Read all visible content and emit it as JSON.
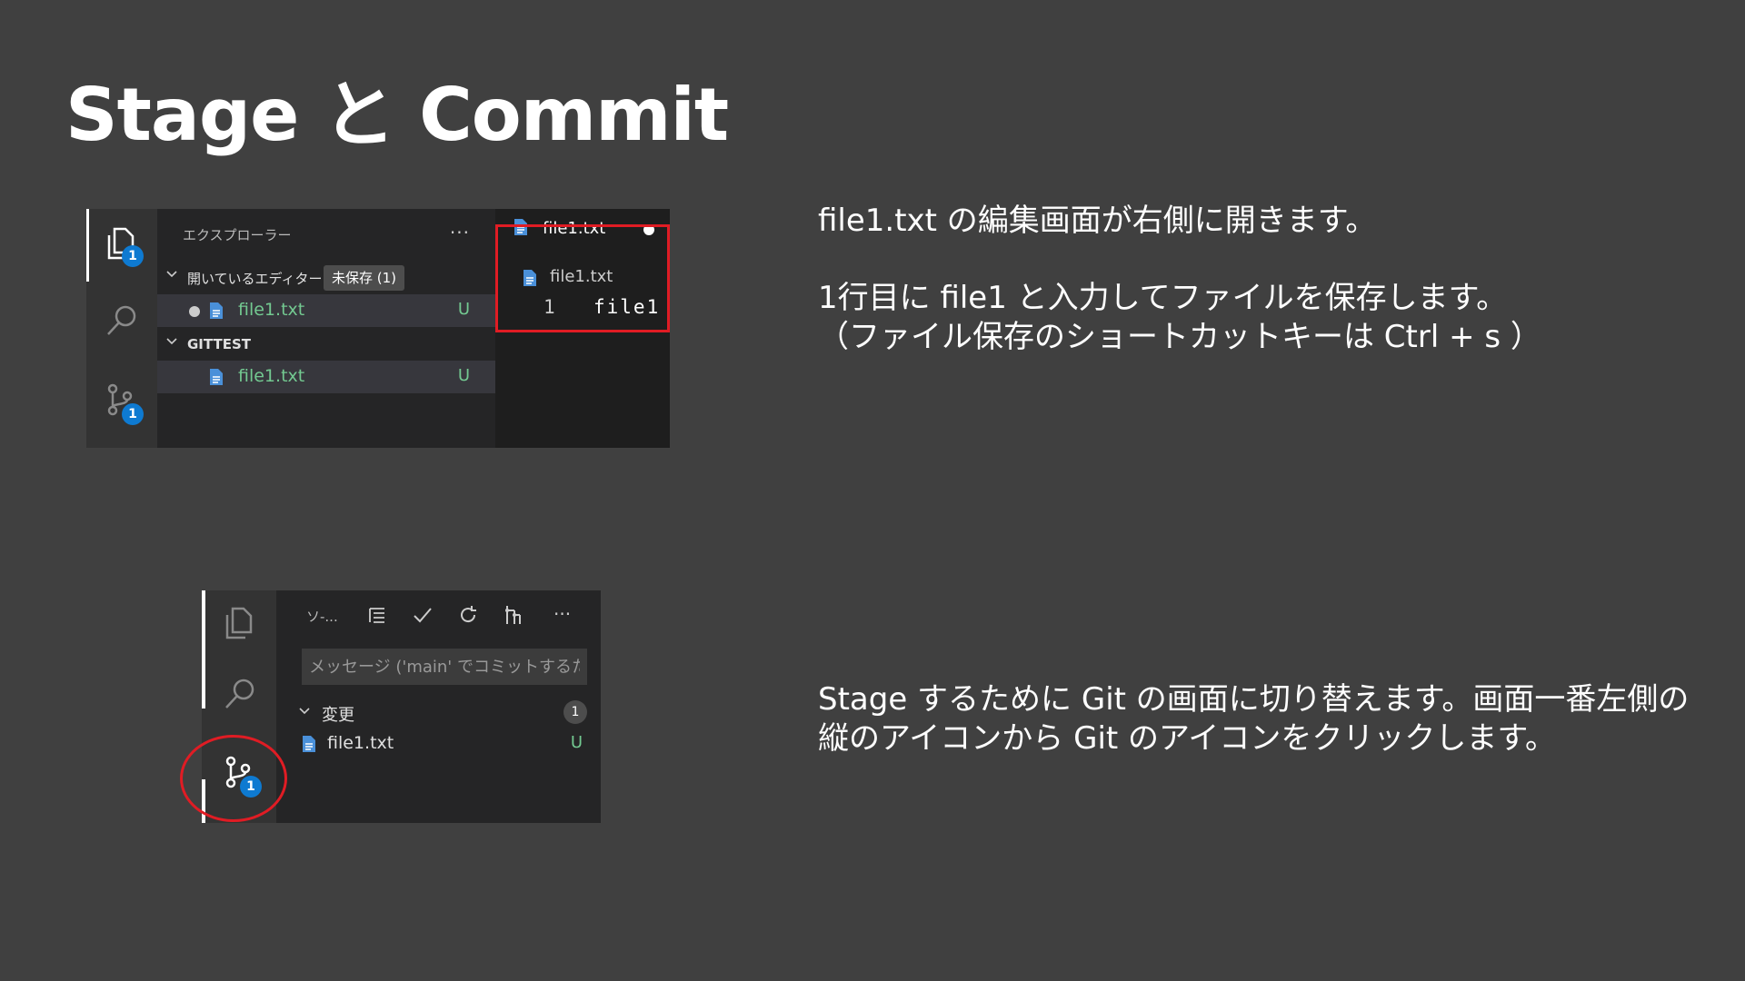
{
  "slide": {
    "title": "Stage と Commit",
    "desc1": "file1.txt の編集画面が右側に開きます。",
    "desc2": "1行目に file1 と入力してファイルを保存します。\n（ファイル保存のショートカットキーは Ctrl + s ）",
    "desc3": "Stage するために Git の画面に切り替えます。画面一番左側の縦のアイコンから Git のアイコンをクリックします。"
  },
  "explorer": {
    "activity": {
      "explorer_badge": "1",
      "scm_badge": "1"
    },
    "header": "エクスプローラー",
    "more": "···",
    "open_editors": {
      "label": "開いているエディター",
      "unsaved": "未保存 (1)",
      "file": "file1.txt",
      "status": "U"
    },
    "workspace": {
      "label": "GITTEST",
      "file": "file1.txt",
      "status": "U"
    },
    "editor": {
      "tab": "file1.txt",
      "breadcrumb": "file1.txt",
      "line_number": "1",
      "code": "file1"
    }
  },
  "scm": {
    "activity": {
      "scm_badge": "1"
    },
    "title": "ソ-...",
    "more": "···",
    "message_placeholder": "メッセージ ('main' でコミットするた...",
    "changes": {
      "label": "変更",
      "count": "1",
      "file": "file1.txt",
      "status": "U"
    }
  },
  "colors": {
    "background": "#404040",
    "accent_badge": "#0e7ad1",
    "highlight_red": "#e01c24",
    "untracked_green": "#73c991"
  }
}
